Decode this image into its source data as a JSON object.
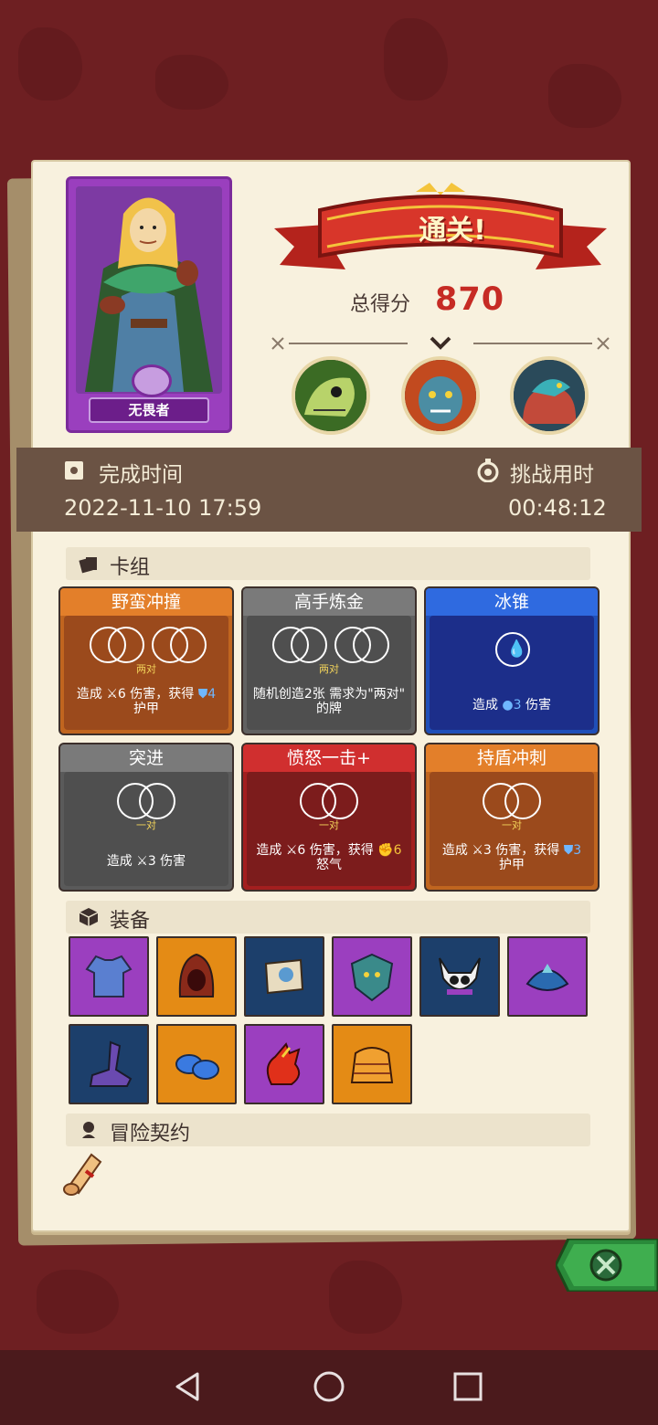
{
  "hero": {
    "name": "无畏者"
  },
  "result": {
    "title": "通关!",
    "score_label": "总得分",
    "score_value": "870"
  },
  "bosses": [
    {
      "icon": "skeleton-dragon-boss-icon"
    },
    {
      "icon": "ogre-boss-icon"
    },
    {
      "icon": "serpent-boss-icon"
    }
  ],
  "time": {
    "finish_label": "完成时间",
    "finish_value": "2022-11-10 17:59",
    "challenge_label": "挑战用时",
    "challenge_value": "00:48:12"
  },
  "deck": {
    "title": "卡组",
    "cards": [
      {
        "name": "野蛮冲撞",
        "tag": "两对",
        "desc_a": "造成",
        "desc_b": "6 伤害，获得",
        "desc_c": "4",
        "desc_d": "护甲",
        "theme": "#c0651f"
      },
      {
        "name": "高手炼金",
        "tag": "两对",
        "desc_a": "随机创造2张 需求为\"两对\"",
        "desc_b": "的牌",
        "desc_c": "",
        "desc_d": "",
        "theme": "#616161"
      },
      {
        "name": "冰锥",
        "tag": "",
        "desc_a": "造成",
        "desc_b": "3",
        "desc_c": "伤害",
        "desc_d": "",
        "theme": "#1f4fb8"
      },
      {
        "name": "突进",
        "tag": "一对",
        "desc_a": "造成",
        "desc_b": "3 伤害",
        "desc_c": "",
        "desc_d": "",
        "theme": "#5a5a5a"
      },
      {
        "name": "愤怒一击+",
        "tag": "一对",
        "desc_a": "造成",
        "desc_b": "6 伤害，获得",
        "desc_c": "6",
        "desc_d": "怒气",
        "theme": "#a31f1f"
      },
      {
        "name": "持盾冲刺",
        "tag": "一对",
        "desc_a": "造成",
        "desc_b": "3 伤害，获得",
        "desc_c": "3",
        "desc_d": "护甲",
        "theme": "#c0651f"
      }
    ]
  },
  "equipment": {
    "title": "装备",
    "items": [
      {
        "icon": "tunic-icon",
        "bg": "#9b3fbf"
      },
      {
        "icon": "hood-icon",
        "bg": "#e48b15"
      },
      {
        "icon": "scroll-icon",
        "bg": "#1c3f6b"
      },
      {
        "icon": "demon-shield-icon",
        "bg": "#9b3fbf"
      },
      {
        "icon": "horned-skull-icon",
        "bg": "#1c3f6b"
      },
      {
        "icon": "crystal-crown-icon",
        "bg": "#9b3fbf"
      },
      {
        "icon": "shadow-boot-icon",
        "bg": "#1c3f6b"
      },
      {
        "icon": "blue-mushroom-icon",
        "bg": "#e48b15"
      },
      {
        "icon": "fire-gauntlet-icon",
        "bg": "#9b3fbf"
      },
      {
        "icon": "orange-robe-icon",
        "bg": "#e48b15"
      }
    ]
  },
  "contract": {
    "title": "冒险契约",
    "icon": "scroll-contract-icon"
  },
  "nav": {
    "back": "back-icon",
    "home": "home-icon",
    "recent": "recent-apps-icon"
  }
}
